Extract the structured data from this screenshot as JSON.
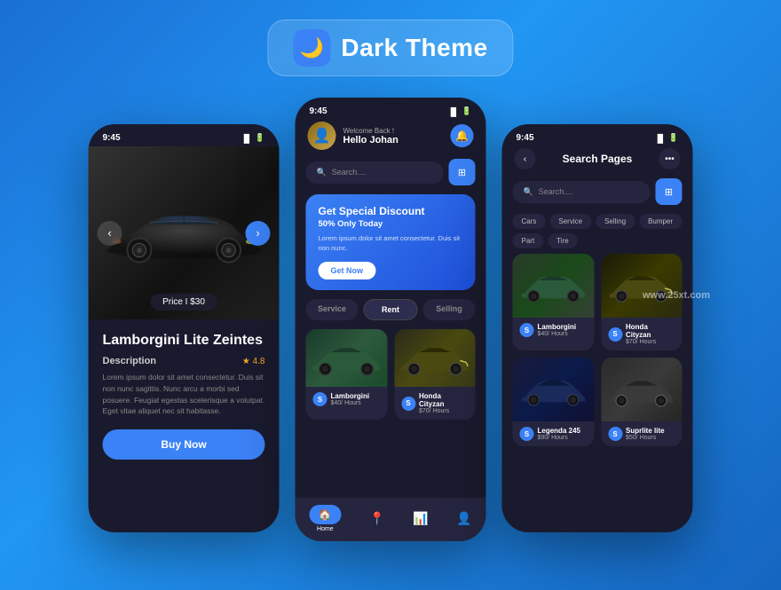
{
  "header": {
    "badge_title": "Dark Theme",
    "moon_icon": "🌙"
  },
  "phone1": {
    "status_time": "9:45",
    "price_badge": "Price I $30",
    "car_name": "Lamborgini Lite Zeintes",
    "description_label": "Description",
    "rating": "★ 4.8",
    "desc_text": "Lorem ipsum dolor sit amet consectetur. Duis sit non nunc sagittis. Nunc arcu a morbi sed posuere. Feugiat egestas scelerisque a volutpat. Eget vitae aliquet nec sit habitasse.",
    "buy_btn": "Buy Now",
    "nav_left": "‹",
    "nav_right": "›"
  },
  "phone2": {
    "status_time": "9:45",
    "welcome": "Welcome Back !",
    "user_name": "Hello Johan",
    "search_placeholder": "Search....",
    "discount_title": "Get Special Discount",
    "discount_sub": "50% Only Today",
    "discount_desc": "Lorem ipsum dolor sit amet consectetur. Duis sit non nunc.",
    "get_now": "Get Now",
    "tabs": [
      "Service",
      "Rent",
      "Selling"
    ],
    "active_tab": "Rent",
    "cars": [
      {
        "name": "Lamborgini",
        "price": "$40/ Hours",
        "logo": "S"
      },
      {
        "name": "Honda Cityzan",
        "price": "$70/ Hours",
        "logo": "S"
      }
    ],
    "nav_items": [
      {
        "icon": "🏠",
        "label": "Home",
        "active": true
      },
      {
        "icon": "📍",
        "label": "",
        "active": false
      },
      {
        "icon": "📊",
        "label": "",
        "active": false
      },
      {
        "icon": "👤",
        "label": "",
        "active": false
      }
    ]
  },
  "phone3": {
    "status_time": "9:45",
    "page_title": "Search Pages",
    "search_placeholder": "Search....",
    "tags": [
      "Cars",
      "Service",
      "Selling",
      "Bumper",
      "Part",
      "Tire"
    ],
    "cars": [
      {
        "name": "Lamborgini",
        "price": "$40/ Hours",
        "logo": "S"
      },
      {
        "name": "Honda Cityzan",
        "price": "$70/ Hours",
        "logo": "S"
      },
      {
        "name": "Legenda 245",
        "price": "$90/ Hours",
        "logo": "S"
      },
      {
        "name": "Suprlite lite",
        "price": "$50/ Hours",
        "logo": "S"
      }
    ]
  },
  "watermark": "www.25xt.com"
}
